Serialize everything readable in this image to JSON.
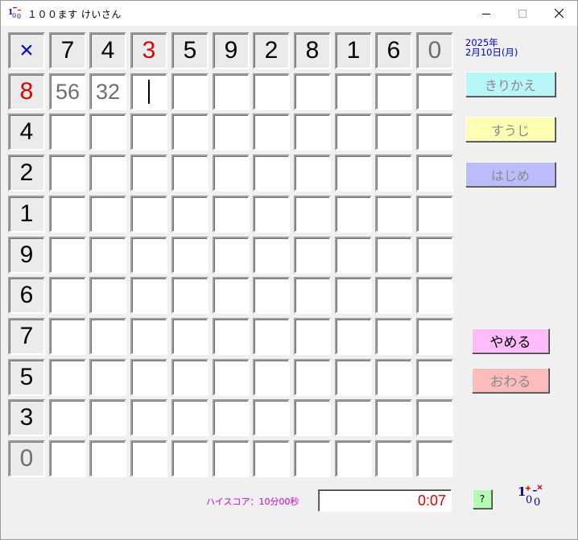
{
  "window": {
    "title": "１００ます けいさん"
  },
  "grid": {
    "operator": "×",
    "top_numbers": [
      "7",
      "4",
      "3",
      "5",
      "9",
      "2",
      "8",
      "1",
      "6",
      "0"
    ],
    "top_number_colors": [
      "#000000",
      "#000000",
      "#e00000",
      "#000000",
      "#000000",
      "#000000",
      "#000000",
      "#000000",
      "#000000",
      "#6e6e6e"
    ],
    "left_numbers": [
      "8",
      "4",
      "2",
      "1",
      "9",
      "6",
      "7",
      "5",
      "3",
      "0"
    ],
    "left_number_colors": [
      "#e00000",
      "#000000",
      "#000000",
      "#000000",
      "#000000",
      "#000000",
      "#000000",
      "#000000",
      "#000000",
      "#6e6e6e"
    ],
    "answers": [
      [
        "56",
        "32",
        "",
        "",
        "",
        "",
        "",
        "",
        "",
        ""
      ],
      [
        "",
        "",
        "",
        "",
        "",
        "",
        "",
        "",
        "",
        ""
      ],
      [
        "",
        "",
        "",
        "",
        "",
        "",
        "",
        "",
        "",
        ""
      ],
      [
        "",
        "",
        "",
        "",
        "",
        "",
        "",
        "",
        "",
        ""
      ],
      [
        "",
        "",
        "",
        "",
        "",
        "",
        "",
        "",
        "",
        ""
      ],
      [
        "",
        "",
        "",
        "",
        "",
        "",
        "",
        "",
        "",
        ""
      ],
      [
        "",
        "",
        "",
        "",
        "",
        "",
        "",
        "",
        "",
        ""
      ],
      [
        "",
        "",
        "",
        "",
        "",
        "",
        "",
        "",
        "",
        ""
      ],
      [
        "",
        "",
        "",
        "",
        "",
        "",
        "",
        "",
        "",
        ""
      ],
      [
        "",
        "",
        "",
        "",
        "",
        "",
        "",
        "",
        "",
        ""
      ]
    ]
  },
  "date": {
    "year": "2025年",
    "monthday": "2月10日(月)"
  },
  "buttons": {
    "kirikae": "きりかえ",
    "suuji": "すうじ",
    "hajime": "はじめ",
    "yameru": "やめる",
    "owaru": "おわる",
    "help": "?"
  },
  "status": {
    "highscore": "ハイスコア：10分00秒",
    "timer": "0:07"
  },
  "colors": {
    "operator": "#0000c8",
    "highlight": "#e00000",
    "disabled": "#6e6e6e"
  }
}
